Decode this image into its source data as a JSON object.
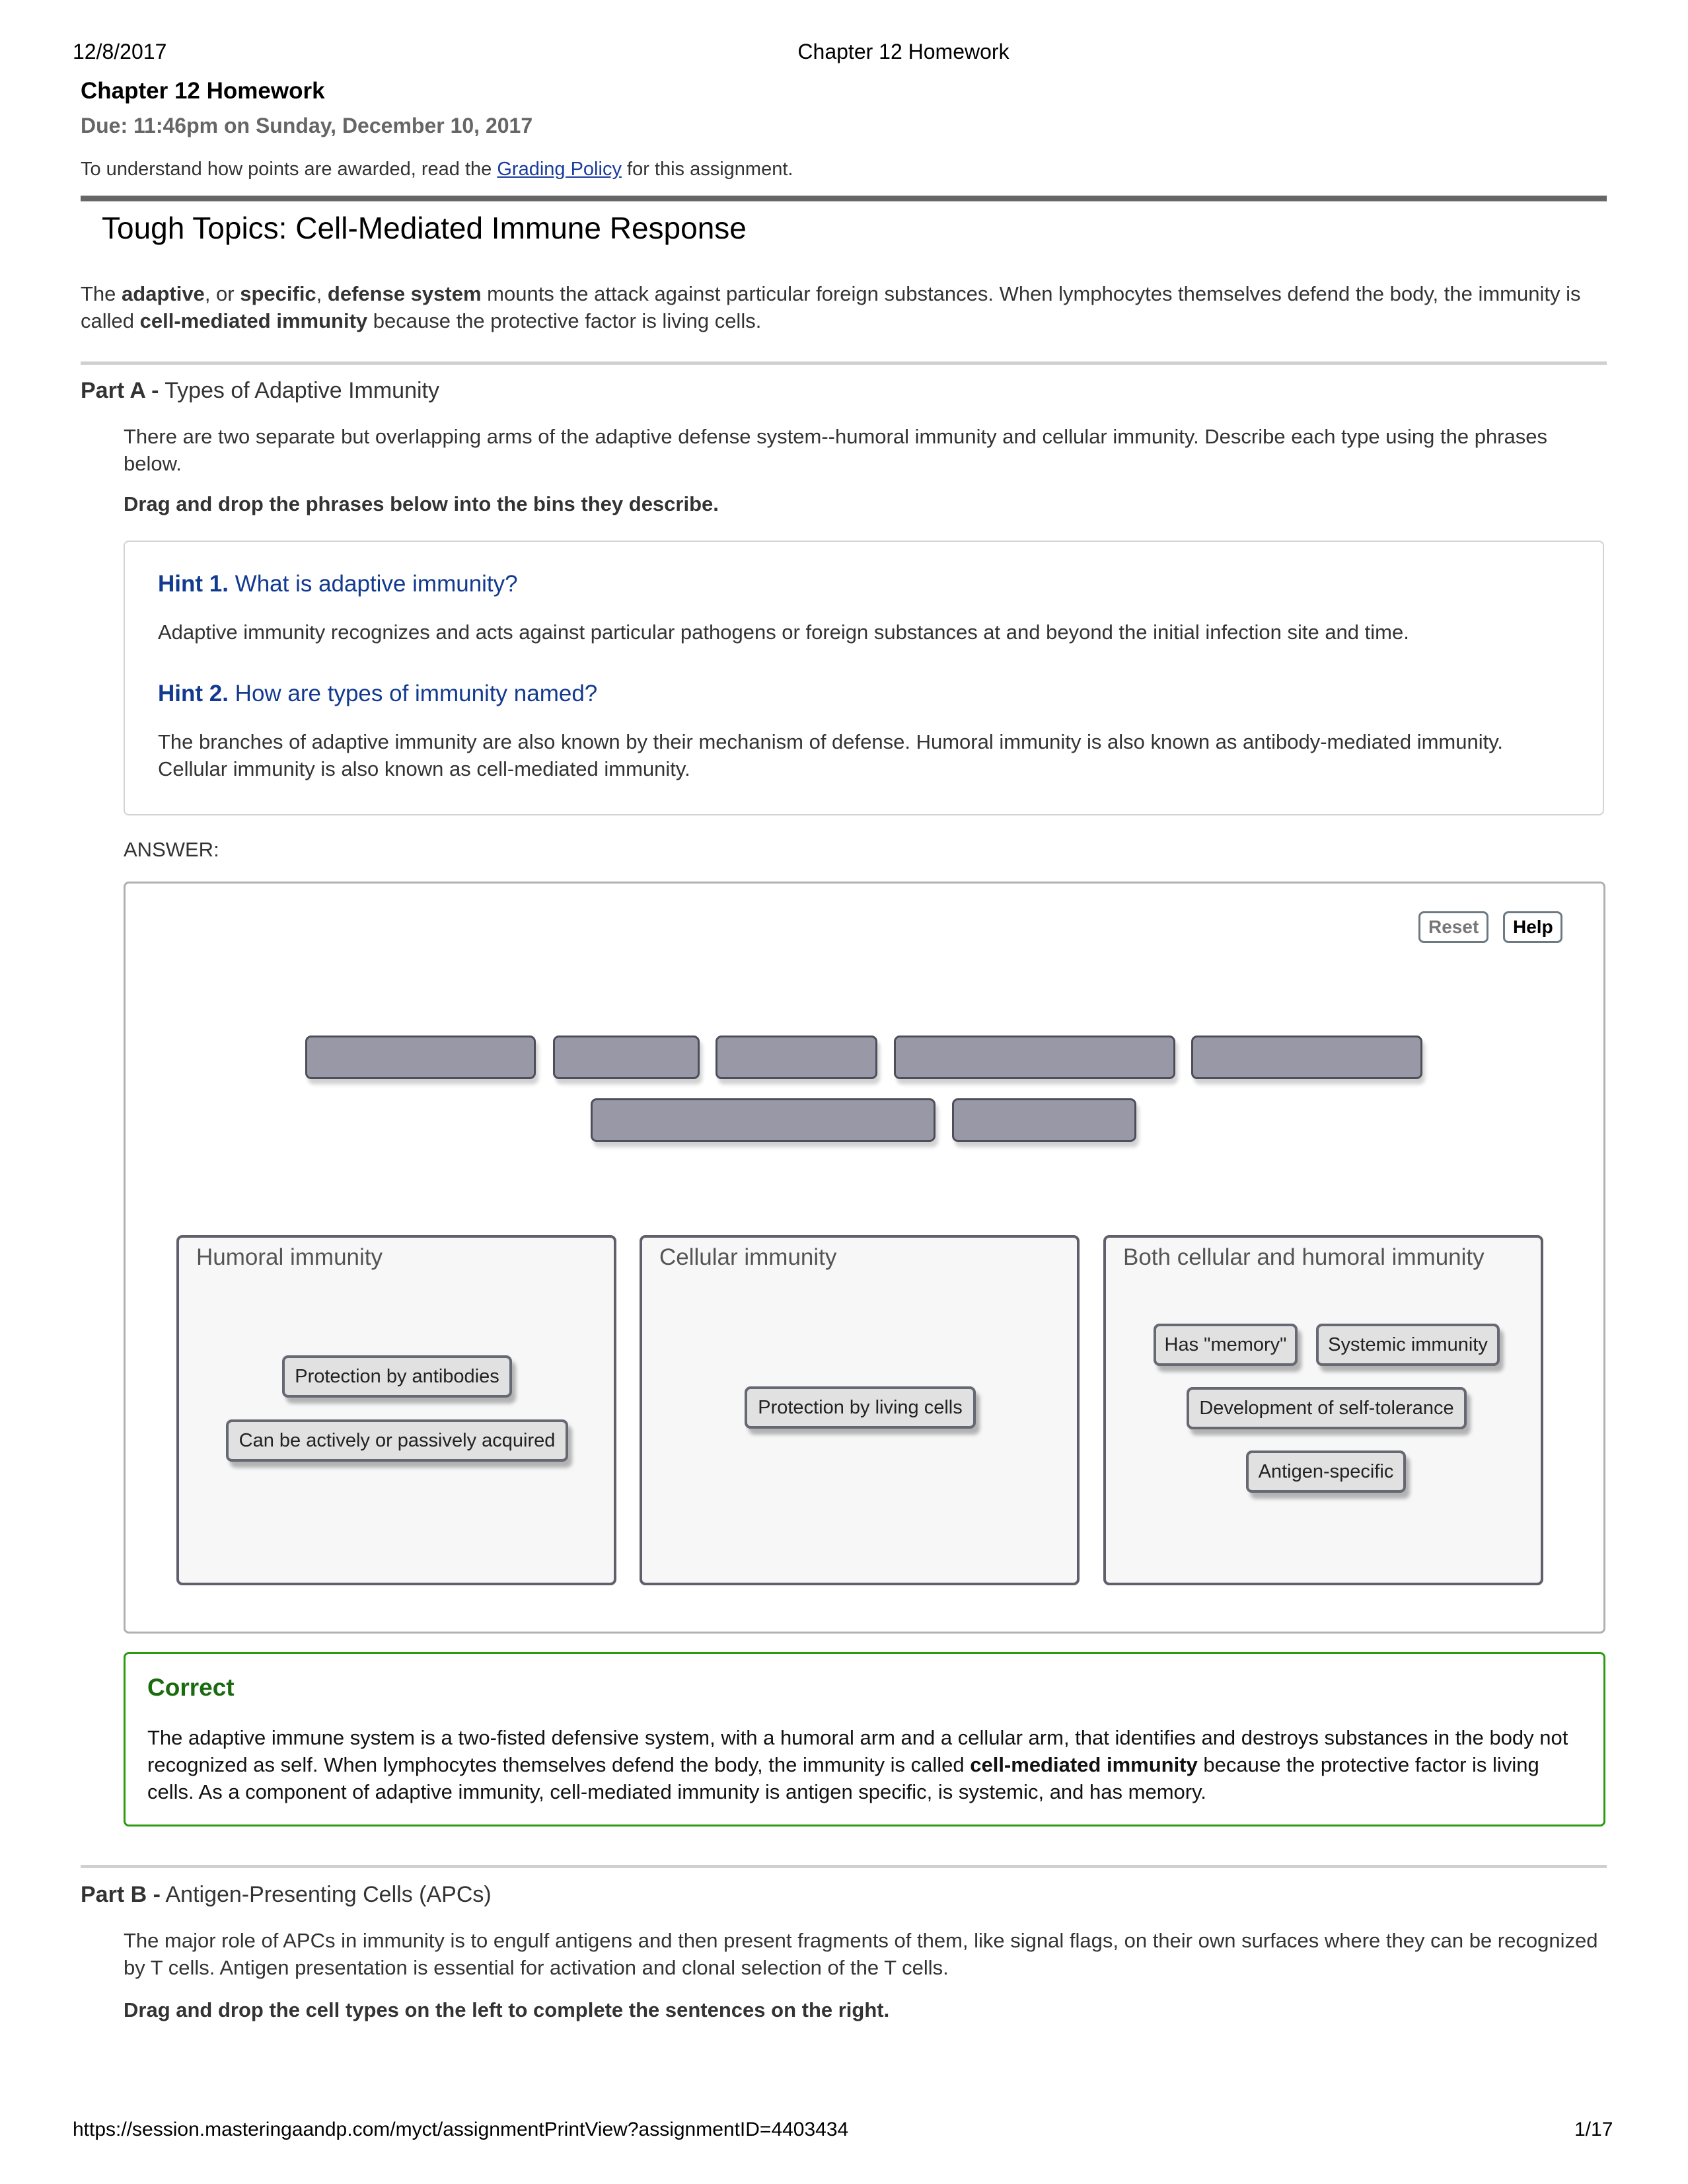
{
  "print_header": {
    "date": "12/8/2017",
    "title": "Chapter 12 Homework"
  },
  "assignment": {
    "title": "Chapter 12 Homework",
    "due": "Due: 11:46pm on Sunday, December 10, 2017",
    "grading_prefix": "To understand how points are awarded, read the ",
    "grading_link": "Grading Policy",
    "grading_suffix": " for this assignment."
  },
  "item": {
    "title": "Tough Topics: Cell-Mediated Immune Response",
    "intro": {
      "t1": "The ",
      "b1": "adaptive",
      "t2": ", or ",
      "b2": "specific",
      "t3": ", ",
      "b3": "defense system",
      "t4": " mounts the attack against particular foreign substances. When lymphocytes themselves defend the body, the immunity is called ",
      "b4": "cell-mediated immunity",
      "t5": " because the protective factor is living cells."
    }
  },
  "part_a": {
    "label": "Part A -",
    "title": " Types of Adaptive Immunity",
    "description": "There are two separate but overlapping arms of the adaptive defense system--humoral immunity and cellular immunity. Describe each type using the phrases below.",
    "instruction": "Drag and drop the phrases below into the bins they describe.",
    "hints": [
      {
        "label": "Hint 1.",
        "title": " What is adaptive immunity?",
        "text": "Adaptive immunity recognizes and acts against particular pathogens or foreign substances at and beyond the initial infection site and time."
      },
      {
        "label": "Hint 2.",
        "title": " How are types of immunity named?",
        "text": "The branches of adaptive immunity are also known by their mechanism of defense. Humoral immunity is also known as antibody-mediated immunity. Cellular immunity is also known as cell-mediated immunity."
      }
    ],
    "answer_label": "ANSWER:",
    "buttons": {
      "reset": "Reset",
      "help": "Help"
    },
    "empty_slot_count": 7,
    "bins": [
      {
        "label": "Humoral immunity",
        "items": [
          "Protection by antibodies",
          "Can be actively or passively acquired"
        ]
      },
      {
        "label": "Cellular immunity",
        "items": [
          "Protection by living cells"
        ]
      },
      {
        "label": "Both cellular and humoral immunity",
        "items": [
          "Has \"memory\"",
          "Systemic immunity",
          "Development of self-tolerance",
          "Antigen-specific"
        ]
      }
    ],
    "feedback": {
      "status": "Correct",
      "t1": "The adaptive immune system is a two-fisted defensive system, with a humoral arm and a cellular arm, that identifies and destroys substances in the body not recognized as self. When lymphocytes themselves defend the body, the immunity is called ",
      "b1": "cell-mediated immunity",
      "t2": " because the protective factor is living cells. As a component of adaptive immunity, cell-mediated immunity is antigen specific, is systemic, and has memory.",
      "color": "#2a9b12"
    }
  },
  "part_b": {
    "label": "Part B -",
    "title": " Antigen-Presenting Cells (APCs)",
    "description": "The major role of APCs in immunity is to engulf antigens and then present fragments of them, like signal flags, on their own surfaces where they can be recognized by T cells. Antigen presentation is essential for activation and clonal selection of the T cells.",
    "instruction": "Drag and drop the cell types on the left to complete the sentences on the right."
  },
  "print_footer": {
    "url": "https://session.masteringaandp.com/myct/assignmentPrintView?assignmentID=4403434",
    "page": "1/17"
  }
}
